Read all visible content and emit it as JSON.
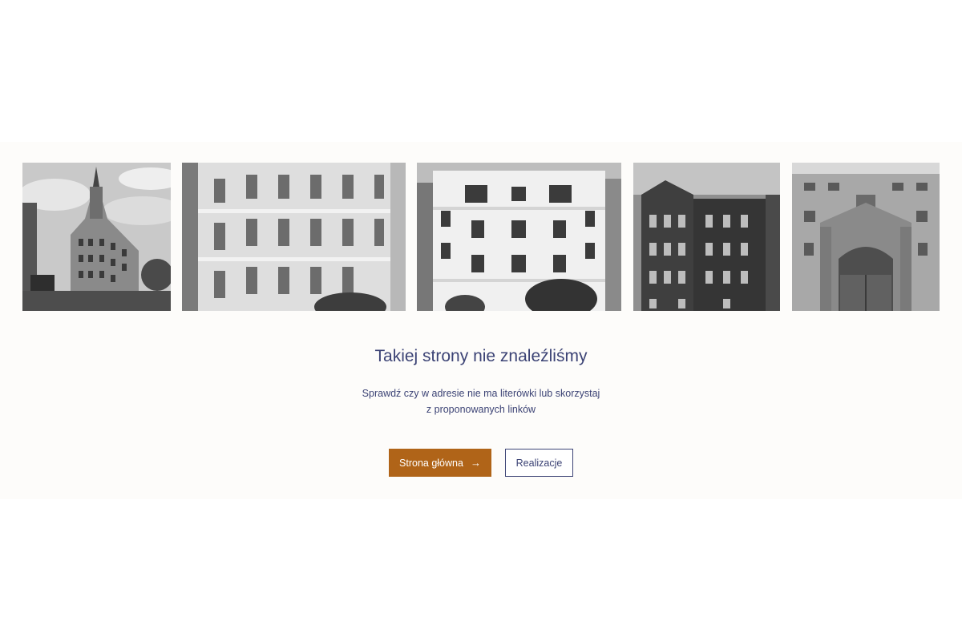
{
  "gallery": {
    "images": [
      {
        "alt": "corner-tenement-building-photo"
      },
      {
        "alt": "white-facade-building-photo"
      },
      {
        "alt": "restored-townhouse-photo"
      },
      {
        "alt": "brick-school-building-photo"
      },
      {
        "alt": "ornate-entrance-facade-photo"
      }
    ]
  },
  "error": {
    "title": "Takiej strony nie znaleźliśmy",
    "description_line1": "Sprawdź czy w adresie nie ma literówki lub skorzystaj",
    "description_line2": "z proponowanych linków"
  },
  "actions": {
    "home_label": "Strona główna",
    "home_icon": "arrow-right-icon",
    "realizations_label": "Realizacje"
  },
  "colors": {
    "primary": "#b06418",
    "text": "#3c4375",
    "band_bg": "#fdfcfa"
  }
}
